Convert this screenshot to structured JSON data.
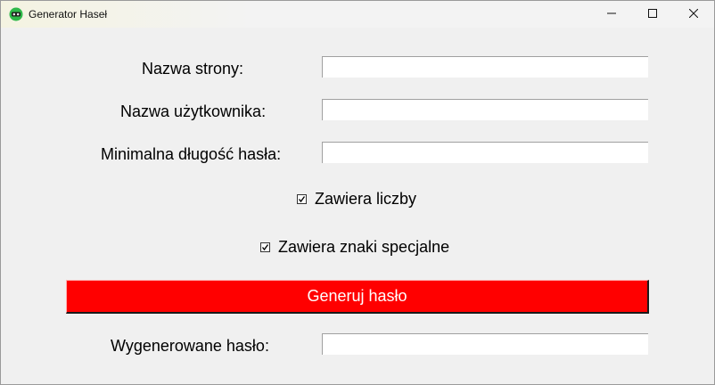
{
  "window": {
    "title": "Generator Haseł",
    "icon": "green-app-icon",
    "controls": [
      "minimize-icon",
      "maximize-icon",
      "close-icon"
    ]
  },
  "form": {
    "site_label": "Nazwa strony:",
    "site_value": "",
    "username_label": "Nazwa użytkownika:",
    "username_value": "",
    "min_length_label": "Minimalna długość hasła:",
    "min_length_value": "",
    "numbers_checkbox_label": "Zawiera liczby",
    "numbers_checked": true,
    "special_checkbox_label": "Zawiera znaki specjalne",
    "special_checked": true
  },
  "actions": {
    "generate_label": "Generuj hasło",
    "generate_bg": "#ff0000",
    "generate_fg": "#ffffff"
  },
  "result": {
    "label": "Wygenerowane hasło:",
    "value": ""
  }
}
